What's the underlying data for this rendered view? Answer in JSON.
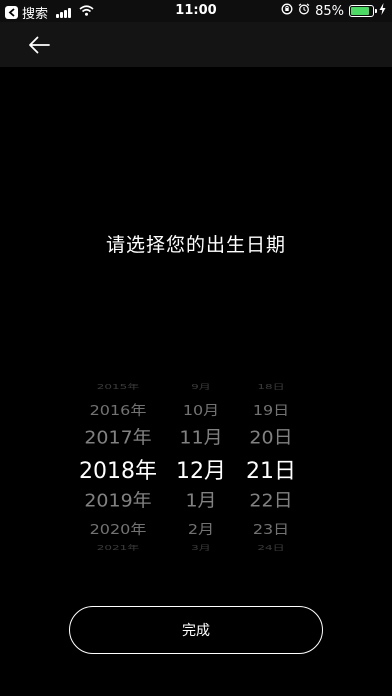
{
  "status_bar": {
    "back_app_label": "搜索",
    "time": "11:00",
    "battery_text": "85%",
    "battery_level": 0.85
  },
  "nav": {
    "back_icon": "arrow-left-icon"
  },
  "title": "请选择您的出生日期",
  "picker": {
    "years": [
      "2015年",
      "2016年",
      "2017年",
      "2018年",
      "2019年",
      "2020年",
      "2021年"
    ],
    "months": [
      "9月",
      "10月",
      "11月",
      "12月",
      "1月",
      "2月",
      "3月"
    ],
    "days": [
      "18日",
      "19日",
      "20日",
      "21日",
      "22日",
      "23日",
      "24日"
    ],
    "selected": {
      "year": "2018年",
      "month": "12月",
      "day": "21日"
    }
  },
  "done_label": "完成",
  "colors": {
    "background": "#000000",
    "battery": "#4cd964",
    "nav_bar": "#141414"
  }
}
